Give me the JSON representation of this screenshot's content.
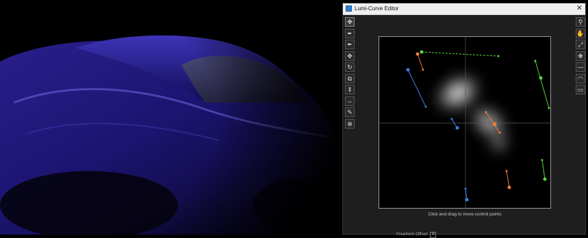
{
  "window": {
    "title": "Lumi-Curve Editor",
    "close_glyph": "✕",
    "app_icon": "curve-editor-app-icon"
  },
  "left_toolbar": {
    "tools": [
      {
        "name": "move-all",
        "icon": "move-arrows-icon",
        "glyph": "✥"
      },
      {
        "name": "pen-add",
        "icon": "pen-plus-icon",
        "glyph": "✒"
      },
      {
        "name": "pen-remove",
        "icon": "pen-minus-icon",
        "glyph": "✒"
      },
      {
        "name": "move-points",
        "icon": "move-points-icon",
        "glyph": "✥"
      },
      {
        "name": "rotate",
        "icon": "rotate-icon",
        "glyph": "↻"
      },
      {
        "name": "scale",
        "icon": "scale-icon",
        "glyph": "⧉"
      },
      {
        "name": "flip-vertical",
        "icon": "flip-vertical-icon",
        "glyph": "⇕"
      },
      {
        "name": "flip-horizontal",
        "icon": "flip-horizontal-icon",
        "glyph": "⇔"
      },
      {
        "name": "brush",
        "icon": "brush-icon",
        "glyph": "✎"
      },
      {
        "name": "delete",
        "icon": "delete-circle-icon",
        "glyph": "⊗"
      }
    ]
  },
  "right_toolbar": {
    "tools": [
      {
        "name": "zoom",
        "icon": "magnifier-icon",
        "glyph": "⚲"
      },
      {
        "name": "pan",
        "icon": "hand-icon",
        "glyph": "✋"
      },
      {
        "name": "fit",
        "icon": "fit-frame-icon",
        "glyph": "⤢"
      },
      {
        "name": "center",
        "icon": "center-icon",
        "glyph": "✥"
      },
      {
        "name": "line",
        "icon": "line-icon",
        "glyph": "—"
      },
      {
        "name": "curve-shape",
        "icon": "curve-shape-icon",
        "glyph": "◠"
      },
      {
        "name": "gradient",
        "icon": "gradient-icon",
        "glyph": "▭"
      }
    ]
  },
  "editor": {
    "hint_text": "Click and drag to move control points",
    "colors": {
      "blue": "#3f7fe6",
      "orange": "#f07a3a",
      "green": "#58d83c"
    }
  },
  "status_bar": {
    "label": "Freeform Offset",
    "close_glyph": "✕"
  }
}
